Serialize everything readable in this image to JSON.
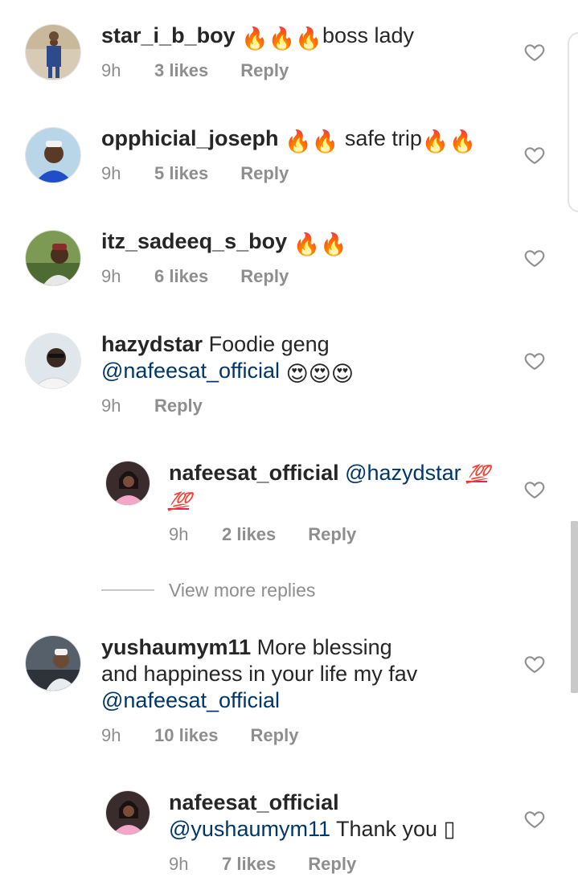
{
  "comments": [
    {
      "username": "star_i_b_boy",
      "text_before": "",
      "emojis": [
        "🔥",
        "🔥",
        "🔥"
      ],
      "text": "boss lady",
      "time": "9h",
      "likes": "3 likes",
      "reply": "Reply"
    },
    {
      "username": "opphicial_joseph",
      "emojis": [
        "🔥",
        "🔥"
      ],
      "text": "safe trip",
      "emojis_after": [
        "🔥",
        "🔥"
      ],
      "time": "9h",
      "likes": "5 likes",
      "reply": "Reply"
    },
    {
      "username": "itz_sadeeq_s_boy",
      "emojis": [
        "🔥",
        "🔥"
      ],
      "time": "9h",
      "likes": "6 likes",
      "reply": "Reply"
    },
    {
      "username": "hazydstar",
      "text": "Foodie geng",
      "mention": "@nafeesat_official",
      "emojis": [
        "😍",
        "😍",
        "😍"
      ],
      "time": "9h",
      "reply": "Reply"
    },
    {
      "username": "nafeesat_official",
      "mention": "@hazydstar",
      "hundred": [
        "💯",
        "💯"
      ],
      "time": "9h",
      "likes": "2 likes",
      "reply": "Reply"
    },
    {
      "username": "yushaumym11",
      "text_line1": "More blessing",
      "text_line2": "and happiness in your life my fav",
      "mention": "@nafeesat_official",
      "time": "9h",
      "likes": "10 likes",
      "reply": "Reply"
    },
    {
      "username": "nafeesat_official",
      "mention": "@yushaumym11",
      "text": "Thank you",
      "trailing_glyph": "▯",
      "time": "9h",
      "likes": "7 likes",
      "reply": "Reply"
    }
  ],
  "view_more_replies": "View more replies",
  "icons": {
    "like": "heart-outline-icon",
    "fire": "fire-emoji",
    "heart_eyes": "heart-eyes-emoji",
    "hundred": "hundred-points-emoji"
  },
  "colors": {
    "username": "#262626",
    "mention": "#00376b",
    "meta": "#8e8e8e",
    "hundred": "#e0245e"
  }
}
